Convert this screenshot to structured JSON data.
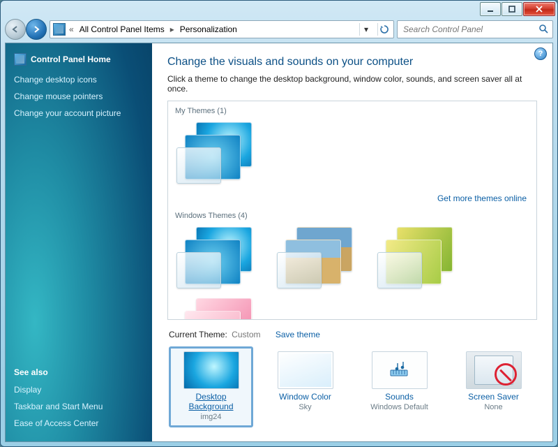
{
  "breadcrumb": {
    "a": "All Control Panel Items",
    "b": "Personalization"
  },
  "search": {
    "placeholder": "Search Control Panel"
  },
  "sidebar": {
    "home": "Control Panel Home",
    "links": [
      "Change desktop icons",
      "Change mouse pointers",
      "Change your account picture"
    ],
    "see_also_title": "See also",
    "see_also": [
      "Display",
      "Taskbar and Start Menu",
      "Ease of Access Center"
    ]
  },
  "title": "Change the visuals and sounds on your computer",
  "subtitle": "Click a theme to change the desktop background, window color, sounds, and screen saver all at once.",
  "groups": {
    "my": "My Themes (1)",
    "win": "Windows Themes (4)"
  },
  "more_link": "Get more themes online",
  "current": {
    "label": "Current Theme:",
    "value": "Custom",
    "save": "Save theme"
  },
  "settings": [
    {
      "name": "Desktop Background",
      "sub": "img24"
    },
    {
      "name": "Window Color",
      "sub": "Sky"
    },
    {
      "name": "Sounds",
      "sub": "Windows Default"
    },
    {
      "name": "Screen Saver",
      "sub": "None"
    }
  ]
}
